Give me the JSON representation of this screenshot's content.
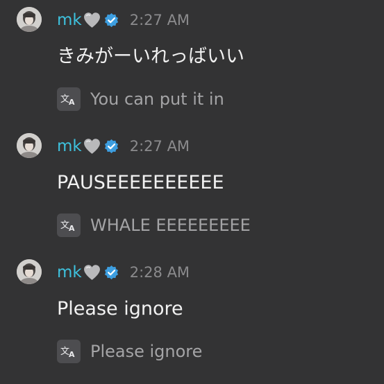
{
  "colors": {
    "background": "#333334",
    "username": "#3ec1dd",
    "verified_badge": "#3d9ee0",
    "heart": "#b9b9bb",
    "timestamp": "#8b8b8d",
    "message_text": "#f2f2f2",
    "translation_text": "#a4a4a6",
    "translate_chip": "#4d4d50"
  },
  "icons": {
    "avatar": "user-avatar",
    "heart": "grey-heart-emoji-icon",
    "verified": "verified-badge-icon",
    "translate": "translate-icon"
  },
  "messages": [
    {
      "username": "mk",
      "timestamp": "2:27 AM",
      "text": "きみがーいれっばいい",
      "translation": "You can put it in"
    },
    {
      "username": "mk",
      "timestamp": "2:27 AM",
      "text": "PAUSEEEEEEEEEE",
      "translation": "WHALE EEEEEEEEE"
    },
    {
      "username": "mk",
      "timestamp": "2:28 AM",
      "text": "Please ignore",
      "translation": "Please ignore"
    }
  ]
}
